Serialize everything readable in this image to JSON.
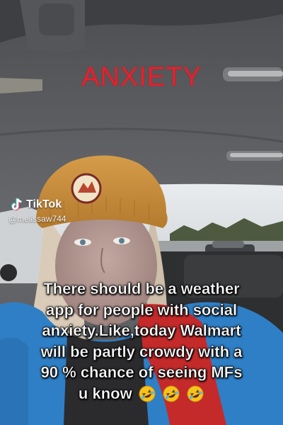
{
  "overlay": {
    "title": "ANXIETY",
    "title_color": "#e6232f"
  },
  "watermark": {
    "brand": "TikTok",
    "handle": "@melissaw744",
    "icon": "tiktok-logo-icon"
  },
  "caption": {
    "lines": [
      "There should be a weather",
      "app for people with social",
      "anxiety.Like,today Walmart",
      "will be partly crowdy with a",
      "90 % chance of seeing MFs",
      "u know"
    ],
    "emoji": [
      "rolling-laughing-emoji",
      "rolling-laughing-emoji",
      "rolling-laughing-emoji"
    ]
  },
  "colors": {
    "beanie": "#c98d3c",
    "jacket": "#2f7fc6",
    "scarf": "#c42a2a",
    "car_ceiling": "#5c5d60"
  }
}
